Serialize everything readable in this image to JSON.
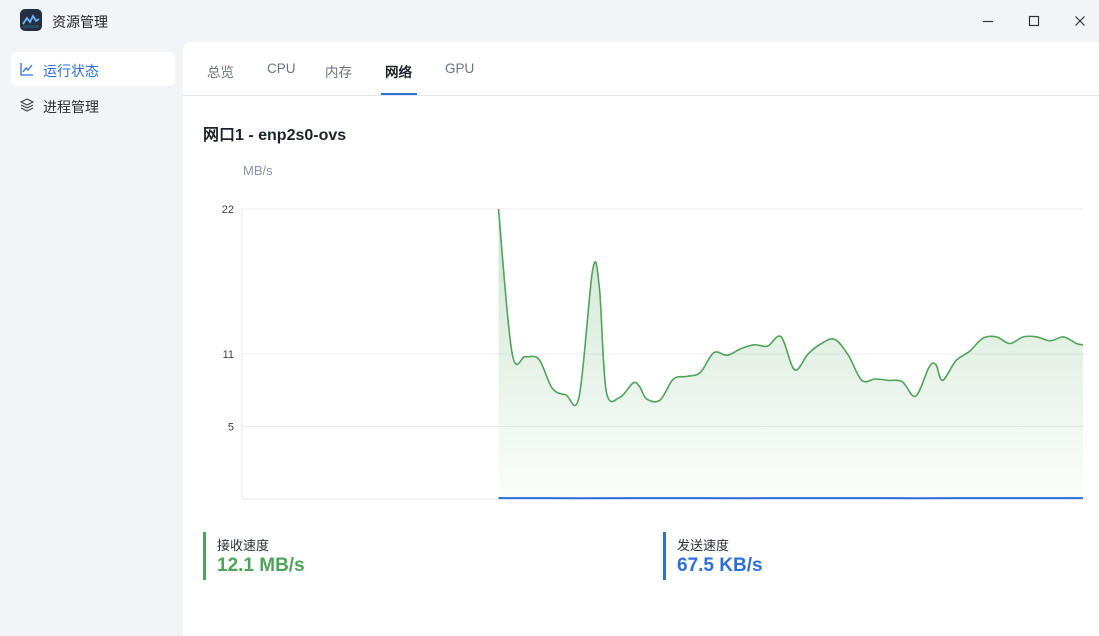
{
  "window": {
    "title": "资源管理",
    "icon": "resource-monitor-icon"
  },
  "sidebar": {
    "items": [
      {
        "label": "运行状态",
        "icon": "line-chart-icon",
        "active": true
      },
      {
        "label": "进程管理",
        "icon": "layers-icon",
        "active": false
      }
    ]
  },
  "tabs": [
    {
      "label": "总览"
    },
    {
      "label": "CPU"
    },
    {
      "label": "内存"
    },
    {
      "label": "网络",
      "active": true
    },
    {
      "label": "GPU"
    }
  ],
  "network": {
    "interface_title": "网口1 - enp2s0-ovs",
    "unit": "MB/s"
  },
  "chart_data": {
    "type": "area",
    "ylabel": "MB/s",
    "ylim": [
      0,
      22
    ],
    "yticks": [
      {
        "value": 22,
        "label": "22"
      },
      {
        "value": 11,
        "label": "11"
      },
      {
        "value": 5.5,
        "label": "5"
      }
    ],
    "x_window": [
      0,
      100
    ],
    "colors": {
      "receive": "#4fa35a",
      "send": "#2d6fd6"
    },
    "series": [
      {
        "name": "接收速度",
        "color": "#4fa35a",
        "x": [
          30.5,
          32.1,
          33.7,
          35.3,
          36.9,
          38.5,
          40.1,
          41.7,
          42.5,
          43.3,
          44.9,
          46.5,
          47.3,
          48.1,
          49.7,
          51.3,
          52.9,
          54.5,
          56.1,
          57.7,
          59.3,
          60.9,
          62.5,
          64.1,
          65.7,
          67.3,
          68.9,
          70.5,
          72.1,
          73.7,
          75.3,
          76.9,
          78.5,
          80.1,
          81.7,
          82.5,
          83.3,
          84.9,
          86.5,
          88.1,
          89.7,
          91.3,
          92.9,
          94.5,
          96.1,
          97.7,
          99.2,
          100
        ],
        "values": [
          22,
          11.1,
          10.8,
          10.6,
          8.4,
          7.9,
          7.8,
          17.4,
          16.0,
          8.2,
          7.7,
          8.8,
          8.5,
          7.6,
          7.5,
          9.1,
          9.3,
          9.6,
          11.1,
          10.9,
          11.4,
          11.7,
          11.6,
          12.3,
          9.8,
          11.0,
          11.8,
          12.1,
          10.9,
          9.0,
          9.1,
          9.0,
          8.9,
          7.8,
          10.0,
          10.2,
          9.0,
          10.5,
          11.2,
          12.2,
          12.3,
          11.8,
          12.3,
          12.3,
          12.0,
          12.3,
          11.8,
          11.7
        ]
      },
      {
        "name": "发送速度",
        "color": "#2d6fd6",
        "x": [
          30.5,
          40,
          50,
          60,
          70,
          80,
          90,
          100
        ],
        "values": [
          0.07,
          0.06,
          0.07,
          0.06,
          0.07,
          0.06,
          0.07,
          0.07
        ]
      }
    ],
    "grid": true,
    "legend": "none"
  },
  "stats": {
    "receive": {
      "label": "接收速度",
      "value": "12.1 MB/s",
      "color": "#4fa35a"
    },
    "send": {
      "label": "发送速度",
      "value": "67.5 KB/s",
      "color": "#2d6fd6"
    }
  }
}
